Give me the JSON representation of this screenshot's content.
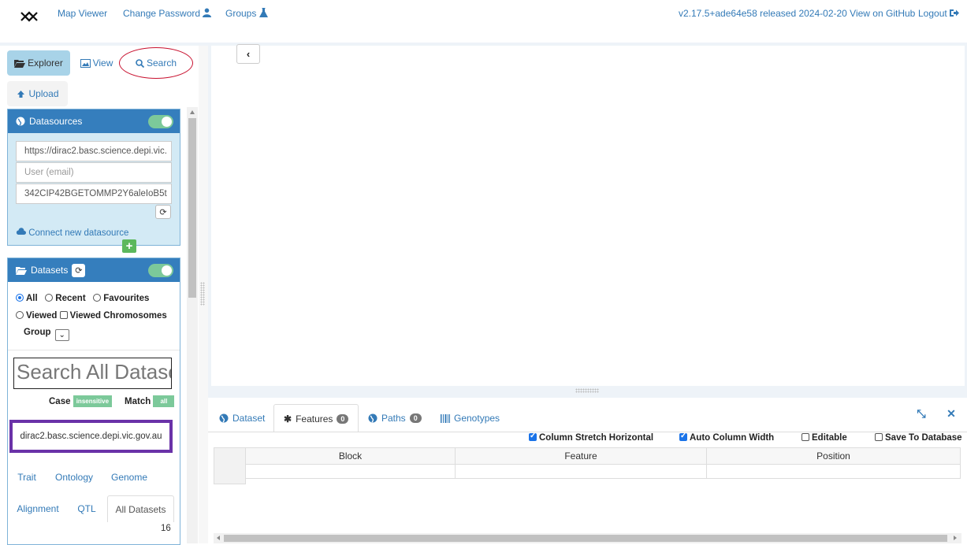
{
  "navbar": {
    "map_viewer": "Map Viewer",
    "change_password": "Change Password",
    "groups": "Groups",
    "version": "v2.17.5+ade64e58 released 2024-02-20 View on GitHub",
    "logout": "Logout"
  },
  "left_tabs": {
    "explorer": "Explorer",
    "view": "View",
    "search": "Search",
    "upload": "Upload"
  },
  "datasources": {
    "title": "Datasources",
    "toggle_on": true,
    "url_value": "https://dirac2.basc.science.depi.vic.",
    "user_placeholder": "User (email)",
    "token_value": "342CIP42BGETOMMP2Y6aleIoB5t",
    "connect_label": "Connect new datasource",
    "plus_label": "+"
  },
  "datasets": {
    "title": "Datasets",
    "toggle_on": true,
    "filter_all": "All",
    "filter_recent": "Recent",
    "filter_favourites": "Favourites",
    "filter_viewed": "Viewed",
    "filter_viewed_chromosomes": "Viewed Chromosomes",
    "group_label": "Group",
    "search_placeholder": "Search All Datasets",
    "case_label": "Case",
    "case_value": "insensitive",
    "match_label": "Match",
    "match_value": "all",
    "server_name": "dirac2.basc.science.depi.vic.gov.au",
    "subtabs": [
      "Trait",
      "Ontology",
      "Genome",
      "Alignment",
      "QTL",
      "All Datasets"
    ],
    "all_datasets_count": "16"
  },
  "bottom": {
    "tabs": [
      {
        "label": "Dataset"
      },
      {
        "label": "Features",
        "count": "0"
      },
      {
        "label": "Paths",
        "count": "0"
      },
      {
        "label": "Genotypes"
      }
    ],
    "options": {
      "column_stretch": "Column Stretch Horizontal",
      "auto_width": "Auto Column Width",
      "editable": "Editable",
      "save_db": "Save To Database"
    },
    "columns": [
      "Block",
      "Feature",
      "Position"
    ]
  },
  "colors": {
    "link": "#337ab7",
    "panel_header": "#357ebd",
    "toggle": "#7cc99a",
    "highlight_box": "#6a32a8",
    "ellipse": "#c8102e"
  }
}
